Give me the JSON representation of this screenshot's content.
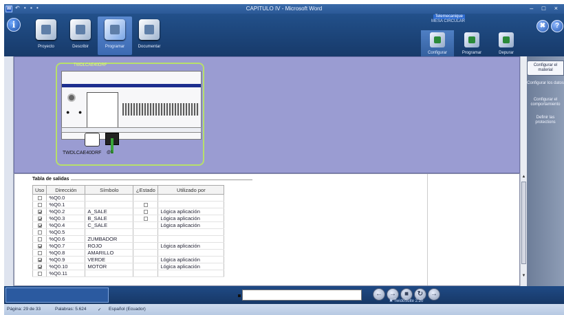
{
  "window": {
    "title": "CAPITULO IV - Microsoft Word",
    "qat": "↶ • ▪ •",
    "controls": "– □ ×"
  },
  "header": {
    "info_glyph": "i",
    "steps": [
      {
        "label": "Proyecto"
      },
      {
        "label": "Describir"
      },
      {
        "label": "Programar"
      },
      {
        "label": "Documentar"
      }
    ],
    "subtitle_line1": "Telemecanique",
    "subtitle_line2": "MESA CIRCULAR",
    "right_buttons": [
      "✖",
      "?"
    ],
    "modes": [
      {
        "label": "Configurar"
      },
      {
        "label": "Programar"
      },
      {
        "label": "Depurar"
      }
    ]
  },
  "module": {
    "title": "TWDLCAE40DRF",
    "label": "TWDLCAE40DRF",
    "port_label": "@1"
  },
  "side_tabs": [
    {
      "label": "Configurar el material"
    },
    {
      "label": "Configurar los datos"
    },
    {
      "label": "Configurar el comportamiento"
    },
    {
      "label": "Definir las protections"
    }
  ],
  "table": {
    "title": "Tabla de salidas",
    "columns": [
      "Uso",
      "Dirección",
      "Símbolo",
      "¿Estado",
      "Utilizado por"
    ],
    "rows": [
      {
        "uso": false,
        "dir": "%Q0.0",
        "sym": "",
        "estado": null,
        "by": ""
      },
      {
        "uso": false,
        "dir": "%Q0.1",
        "sym": "",
        "estado": false,
        "by": ""
      },
      {
        "uso": true,
        "dir": "%Q0.2",
        "sym": "A_SALE",
        "estado": false,
        "by": "Lógica aplicación"
      },
      {
        "uso": true,
        "dir": "%Q0.3",
        "sym": "B_SALE",
        "estado": false,
        "by": "Lógica aplicación"
      },
      {
        "uso": true,
        "dir": "%Q0.4",
        "sym": "C_SALE",
        "estado": null,
        "by": "Lógica aplicación"
      },
      {
        "uso": false,
        "dir": "%Q0.5",
        "sym": "",
        "estado": null,
        "by": ""
      },
      {
        "uso": false,
        "dir": "%Q0.6",
        "sym": "ZUMBADOR",
        "estado": null,
        "by": ""
      },
      {
        "uso": true,
        "dir": "%Q0.7",
        "sym": "ROJO",
        "estado": null,
        "by": "Lógica aplicación"
      },
      {
        "uso": false,
        "dir": "%Q0.8",
        "sym": "AMARILLO",
        "estado": null,
        "by": ""
      },
      {
        "uso": true,
        "dir": "%Q0.9",
        "sym": "VERDE",
        "estado": null,
        "by": "Lógica aplicación"
      },
      {
        "uso": true,
        "dir": "%Q0.10",
        "sym": "MOTOR",
        "estado": null,
        "by": "Lógica aplicación"
      },
      {
        "uso": false,
        "dir": "%Q0.11",
        "sym": "",
        "estado": null,
        "by": ""
      }
    ]
  },
  "bottom": {
    "nav": [
      "←",
      "→",
      "■",
      "↻",
      "→"
    ],
    "version": "✖ TwidoSuite 2.20"
  },
  "status": {
    "page": "Página: 29 de 33",
    "words": "Palabras: 5.624",
    "language": "Español (Ecuador)"
  },
  "colors": {
    "accent": "#2f6cd0",
    "module_outline": "#b7e06a",
    "canvas": "#9a9cd2"
  }
}
